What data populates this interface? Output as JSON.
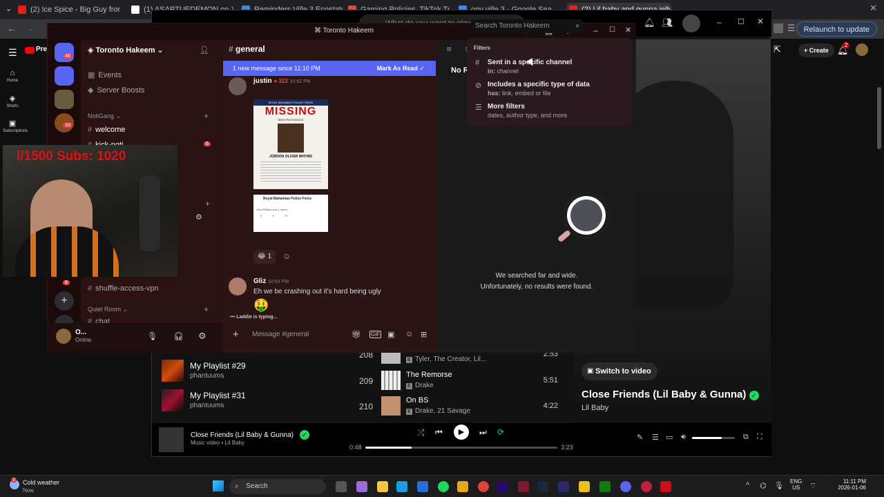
{
  "browser": {
    "tabs": [
      {
        "label": "(2) Ice Spice - Big Guy from \"Th",
        "color": "#e62117"
      },
      {
        "label": "(1) ASAPTUEDEMON on X: \"Is",
        "color": "#ffffff"
      },
      {
        "label": "Reminders Ville 3 Ecostats",
        "color": "#3b8ad8"
      },
      {
        "label": "Gaming Policies, TikTok Trust",
        "color": "#e04848"
      },
      {
        "label": "ogy ville 3 - Google Sea",
        "color": "#4285f4"
      },
      {
        "label": "(2) Lil baby and gunna jelly feli",
        "color": "#e62117"
      }
    ],
    "relaunch": "Relaunch to update"
  },
  "youtube": {
    "brand": "Premi",
    "nav": [
      "Home",
      "Shorts",
      "Subscriptions"
    ],
    "create": "Create",
    "notif_count": "2"
  },
  "music": {
    "window_search_placeholder": "What do you want to play?",
    "playlists": [
      {
        "title": "My Playlist #29",
        "owner": "phantuums"
      },
      {
        "title": "My Playlist #31",
        "owner": "phantuums"
      }
    ],
    "tracks": [
      {
        "num": "208",
        "title": "",
        "artists": "Tyler, The Creator, Lil...",
        "dur": "2:53"
      },
      {
        "num": "209",
        "title": "The Remorse",
        "artists": "Drake",
        "dur": "5:51"
      },
      {
        "num": "210",
        "title": "On BS",
        "artists": "Drake, 21 Savage",
        "dur": "4:22"
      }
    ],
    "switch_video": "Switch to video",
    "now_playing_title": "Close Friends (Lil Baby & Gunna)",
    "now_playing_artist": "Lil Baby",
    "player": {
      "title": "Close Friends (Lil Baby & Gunna)",
      "sub": "Music video • Lil Baby",
      "elapsed": "0:48",
      "total": "3:23",
      "progress": 0.24,
      "volume": 0.7
    }
  },
  "discord": {
    "window_title": "Toronto Hakeem",
    "server_name": "Toronto Hakeem",
    "guild_badges": [
      "46",
      "10",
      "6"
    ],
    "channels": {
      "top": [
        "Events",
        "Server Boosts"
      ],
      "category1": "NotiGang",
      "list1": [
        {
          "name": "welcome"
        },
        {
          "name": "kick-noti",
          "badge": "5"
        }
      ],
      "list2": [
        {
          "name": "shuffle-access-vpn"
        }
      ],
      "category2": "Quiet Room",
      "list3": [
        {
          "name": "chat"
        }
      ]
    },
    "user": {
      "name": "O...",
      "status": "Online"
    },
    "channel_name": "general",
    "new_message_bar": "1 new message since 11:10 PM",
    "mark_as_read": "Mark As Read",
    "messages": [
      {
        "author": "justin",
        "badge": "323",
        "time": "10:52 PM"
      },
      {
        "author": "Gliz",
        "time": "10:53 PM",
        "text": "Eh we be crashing out it's hard being ugly"
      }
    ],
    "poster": {
      "header": "ROYAL BAHAMAS POLICE FORCE",
      "missing": "MISSING",
      "place": "NEW PROVIDENCE",
      "name": "JORDON OLIVER WHYMS",
      "post_author": "Royal Bahamian Police Force",
      "post_meta": "Gina Phillips and 4 others",
      "counts": [
        "5",
        "5",
        "76"
      ]
    },
    "reaction_count": "1",
    "typing": "Laddie is typing...",
    "composer_placeholder": "Message #general",
    "search_placeholder": "Search Toronto Hakeem",
    "no_results_label": "No R",
    "filters": {
      "heading": "Filters",
      "items": [
        {
          "title": "Sent in a specific channel",
          "key": "in:",
          "desc": "channel",
          "icon": "hash-icon"
        },
        {
          "title": "Includes a specific type of data",
          "key": "has:",
          "desc": "link, embed or file",
          "icon": "paperclip-icon"
        },
        {
          "title": "More filters",
          "key": "",
          "desc": "dates, author type, and more",
          "icon": "sliders-icon"
        }
      ]
    },
    "empty_line1": "We searched far and wide.",
    "empty_line2": "Unfortunately, no results were found."
  },
  "stream_overlay": {
    "subs": "l/1500  Subs: 1020"
  },
  "taskbar": {
    "weather_title": "Cold weather",
    "weather_sub": "Now",
    "search": "Search",
    "lang1": "ENG",
    "lang2": "US",
    "time": "11:11 PM",
    "date": "2026-01-06",
    "weather_badge": "3"
  }
}
